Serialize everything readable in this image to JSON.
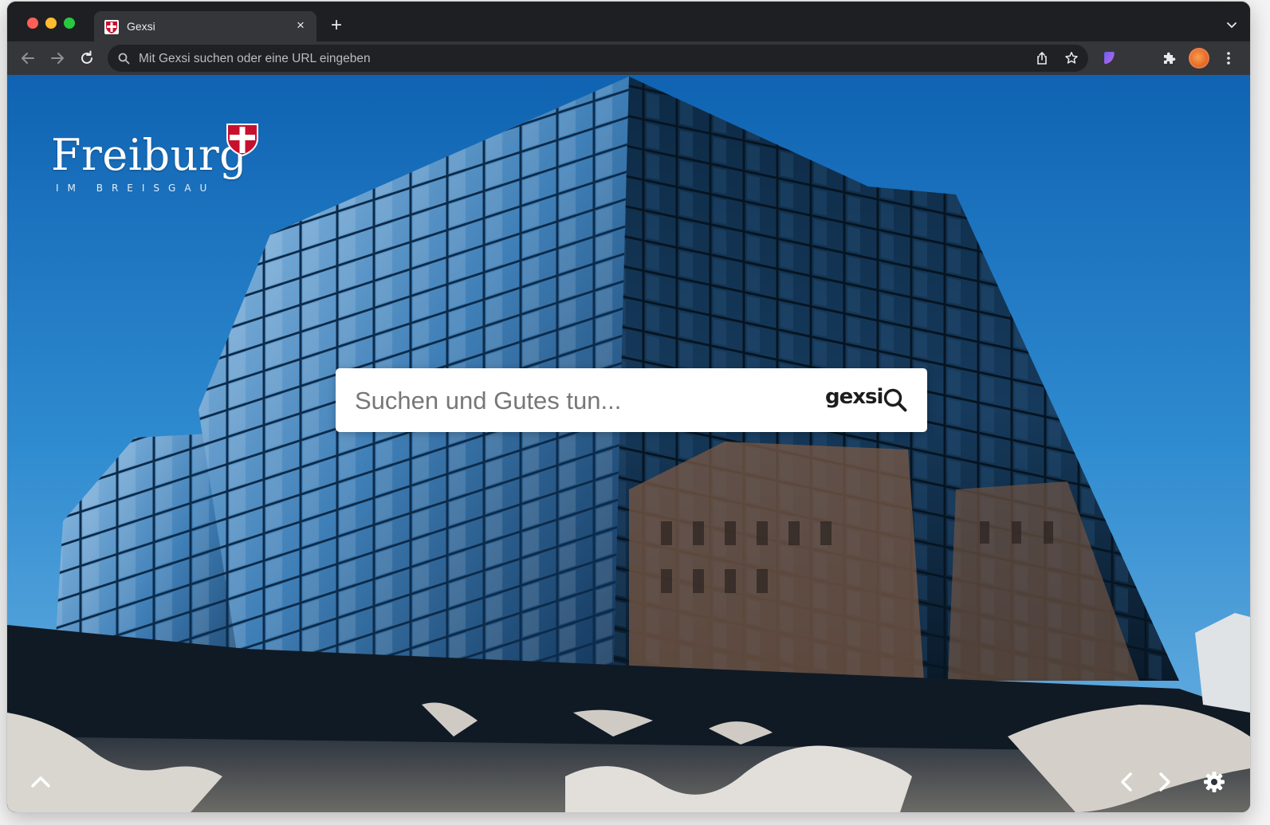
{
  "browser": {
    "tab": {
      "title": "Gexsi",
      "favicon": "freiburg-shield-icon"
    },
    "new_tab_symbol": "+",
    "close_symbol": "×",
    "omnibox": {
      "placeholder": "Mit Gexsi suchen oder eine URL eingeben"
    },
    "toolbar_icons": [
      "back-icon",
      "forward-icon",
      "reload-icon",
      "share-icon",
      "bookmark-star-icon",
      "extension-icon",
      "puzzle-icon",
      "profile-avatar",
      "menu-dots-icon"
    ]
  },
  "page": {
    "logo": {
      "word": "Freiburg",
      "subtitle": "IM BREISGAU"
    },
    "search": {
      "placeholder": "Suchen und Gutes tun...",
      "brand": "gexsi"
    },
    "controls": [
      "scroll-up-icon",
      "previous-image-icon",
      "next-image-icon",
      "settings-gear-icon"
    ]
  },
  "colors": {
    "sky": "#2a86cc",
    "browser_frame": "#202124",
    "toolbar": "#35363a",
    "shield_red": "#c8102e"
  }
}
